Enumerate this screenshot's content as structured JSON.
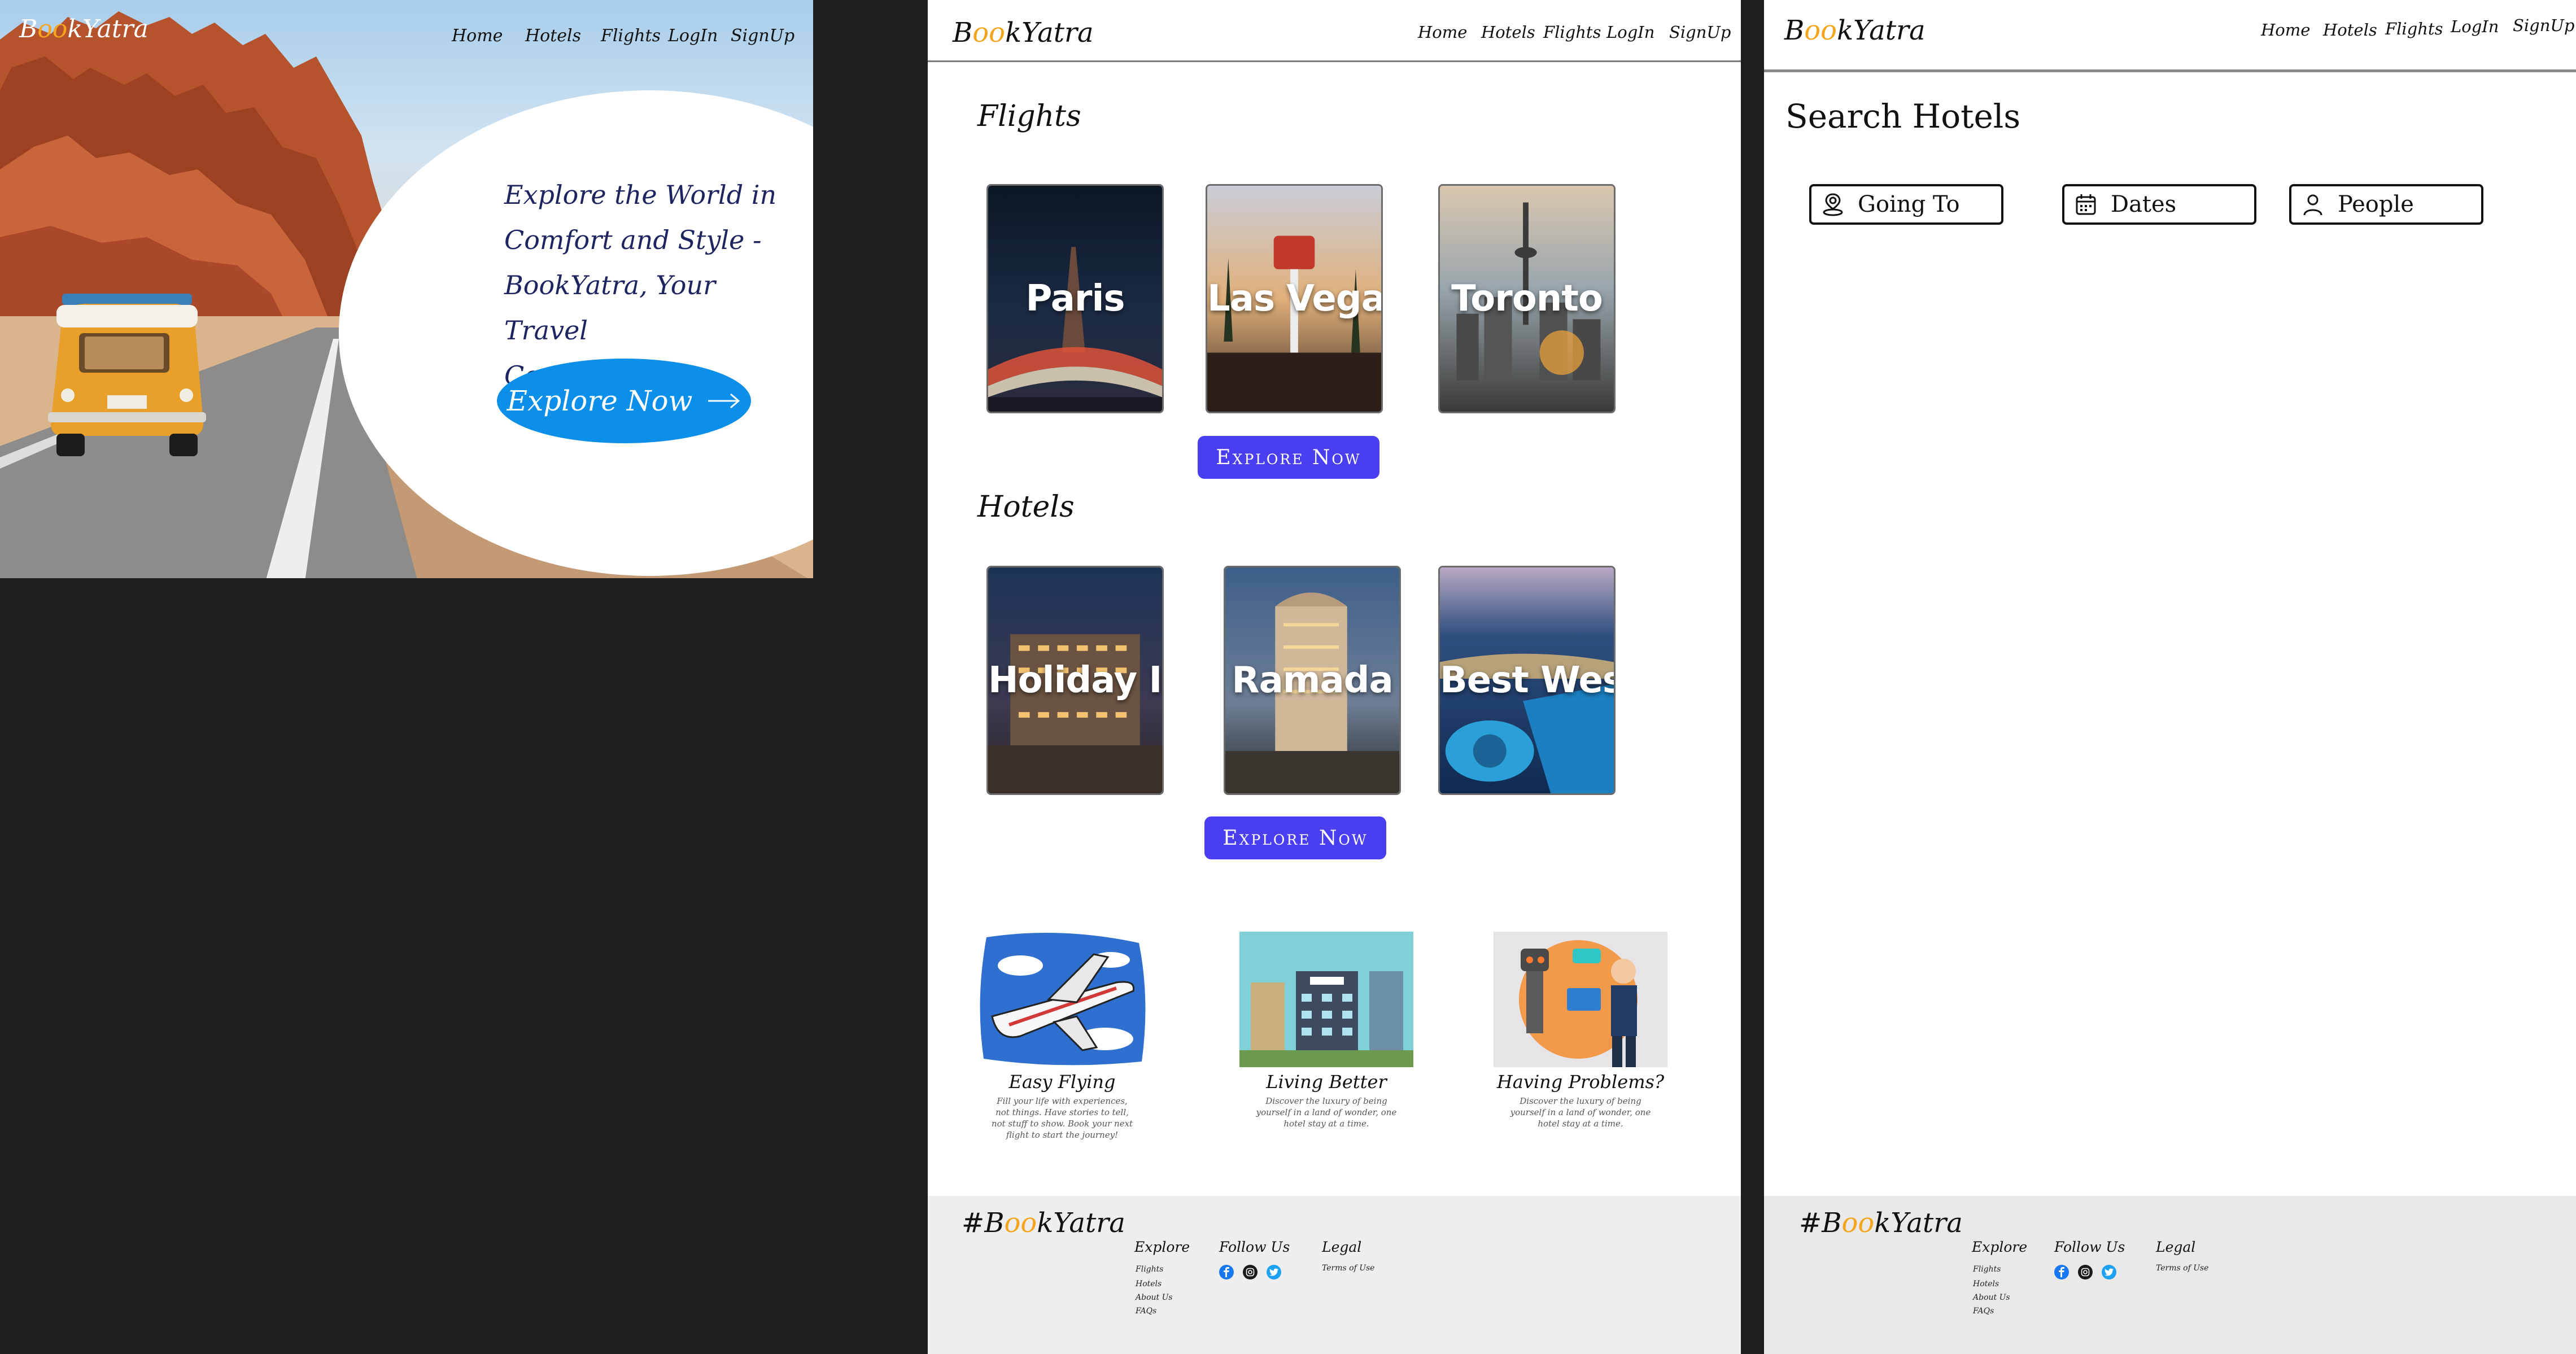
{
  "hero": {
    "logo_prefix": "B",
    "logo_oo": "oo",
    "logo_suffix": "kYatra",
    "nav": [
      "Home",
      "Hotels",
      "Flights",
      "LogIn",
      "SignUp"
    ],
    "tagline_lines": [
      "Explore the World in",
      "Comfort and Style -",
      "BookYatra, Your Travel",
      "Companion."
    ],
    "cta_label": "Explore Now",
    "cta_icon": "arrow-right-icon"
  },
  "landing": {
    "logo_prefix": "B",
    "logo_oo": "oo",
    "logo_suffix": "kYatra",
    "nav": [
      "Home",
      "Hotels",
      "Flights",
      "LogIn",
      "SignUp"
    ],
    "flights_title": "Flights",
    "flights": [
      "Paris",
      "Las Vegas",
      "Toronto"
    ],
    "flights_button": "Explore Now",
    "hotels_title": "Hotels",
    "hotels": [
      "Holiday Inn",
      "Ramada",
      "Best Western"
    ],
    "hotels_button": "Explore Now",
    "features": [
      {
        "title": "Easy Flying",
        "desc": "Fill your life with experiences, not things. Have stories to tell, not stuff to show. Book your next flight to start the journey!"
      },
      {
        "title": "Living Better",
        "desc": "Discover the luxury of being yourself in a land of wonder, one hotel stay at a time."
      },
      {
        "title": "Having Problems?",
        "desc": "Discover the luxury of being yourself in a land of wonder, one hotel stay at a time."
      }
    ],
    "colors": {
      "accent_button": "#4a3ff0",
      "logo_oo": "#f4a51c",
      "hero_cta": "#0b8fe8"
    }
  },
  "footer": {
    "logo_hash": "#B",
    "logo_oo": "oo",
    "logo_suffix": "kYatra",
    "explore_title": "Explore",
    "explore_links": [
      "Flights",
      "Hotels",
      "About Us",
      "FAQs"
    ],
    "follow_title": "Follow Us",
    "social_icons": [
      "facebook-icon",
      "instagram-icon",
      "twitter-icon"
    ],
    "legal_title": "Legal",
    "legal_links": [
      "Terms of Use"
    ]
  },
  "search": {
    "logo_prefix": "B",
    "logo_oo": "oo",
    "logo_suffix": "kYatra",
    "nav": [
      "Home",
      "Hotels",
      "Flights",
      "LogIn",
      "SignUp"
    ],
    "title": "Search Hotels",
    "fields": [
      {
        "label": "Going To",
        "icon": "location-pin-icon"
      },
      {
        "label": "Dates",
        "icon": "calendar-icon"
      },
      {
        "label": "People",
        "icon": "person-icon"
      }
    ]
  }
}
